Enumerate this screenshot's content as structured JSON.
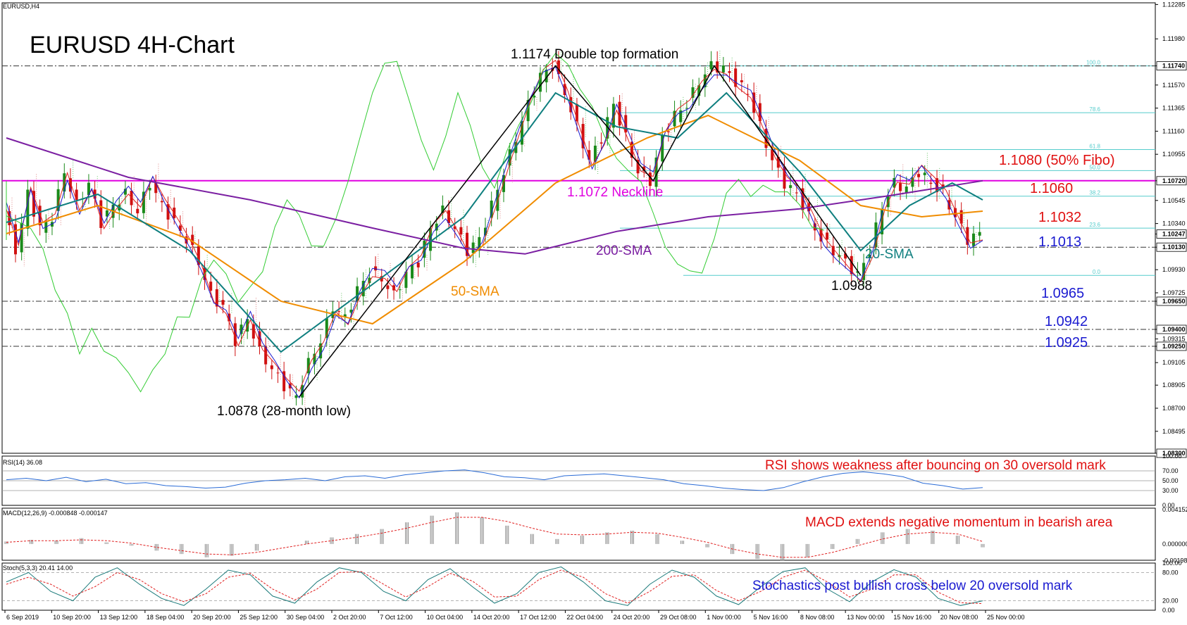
{
  "window_title": "EURUSD,H4",
  "chart_title": "EURUSD 4H-Chart",
  "colors": {
    "background": "#ffffff",
    "candle_up": "#1a8a1a",
    "candle_down": "#d01010",
    "sma20": "#0f7f7f",
    "sma50": "#f08c00",
    "sma200": "#7b1fa2",
    "neckline": "#e000e0",
    "tenkan": "#e02020",
    "kijun": "#1a1ad0",
    "chikou": "#33cc33",
    "fib": "#55cccc",
    "rsi": "#2a6bd6",
    "macd_signal": "#e02020",
    "stoch_signal": "#e02020"
  },
  "annotations": {
    "double_top": "1.1174 Double top formation",
    "neckline": "1.1072 Neckline",
    "fib50": "1.1080 (50% Fibo)",
    "level_1060": "1.1060",
    "level_1032": "1.1032",
    "level_1013": "1.1013",
    "level_0965": "1.0965",
    "level_0942": "1.0942",
    "level_0925": "1.0925",
    "low_0988": "1.0988",
    "low_0878": "1.0878 (28-month low)",
    "sma200_label": "200-SMA",
    "sma50_label": "50-SMA",
    "sma20_label": "20-SMA",
    "rsi_note": "RSI shows weakness after bouncing on 30 oversold mark",
    "macd_note": "MACD extends negative momentum in bearish area",
    "stoch_note": "Stochastics post bullish cross below 20 oversold mark"
  },
  "indicators": {
    "rsi_header": "RSI(14) 36.08",
    "macd_header": "MACD(12,26,9) -0.000848 -0.000147",
    "stoch_header": "Stoch(5,3,3) 20.41 14.00"
  },
  "chart_data": [
    {
      "type": "candlestick",
      "title": "EURUSD 4H-Chart",
      "symbol": "EURUSD",
      "timeframe": "H4",
      "ylim": [
        1.083,
        1.123
      ],
      "y_ticks": [
        "1.12285",
        "1.11980",
        "1.11740",
        "1.11570",
        "1.11365",
        "1.11160",
        "1.10955",
        "1.10720",
        "1.10545",
        "1.10340",
        "1.10247",
        "1.10130",
        "1.09930",
        "1.09725",
        "1.09650",
        "1.09400",
        "1.09315",
        "1.09250",
        "1.09105",
        "1.08905",
        "1.08700",
        "1.08495",
        "1.08300"
      ],
      "x_ticks": [
        "6 Sep 2019",
        "10 Sep 20:00",
        "13 Sep 12:00",
        "18 Sep 04:00",
        "20 Sep 20:00",
        "25 Sep 12:00",
        "30 Sep 04:00",
        "2 Oct 20:00",
        "7 Oct 12:00",
        "10 Oct 04:00",
        "14 Oct 20:00",
        "17 Oct 12:00",
        "22 Oct 04:00",
        "24 Oct 20:00",
        "29 Oct 08:00",
        "1 Nov 00:00",
        "5 Nov 16:00",
        "8 Nov 08:00",
        "13 Nov 00:00",
        "15 Nov 16:00",
        "20 Nov 08:00",
        "25 Nov 00:00"
      ],
      "price_labels": [
        "1.11740",
        "1.10720",
        "1.10247",
        "1.10130",
        "1.09650",
        "1.09400",
        "1.09250",
        "1.08300"
      ],
      "fibonacci": [
        {
          "label": "100.0",
          "value": 1.1174
        },
        {
          "label": "78.6",
          "value": 1.11324
        },
        {
          "label": "61.8",
          "value": 1.10997
        },
        {
          "label": "50.0",
          "value": 1.1081
        },
        {
          "label": "38.2",
          "value": 1.10583
        },
        {
          "label": "23.6",
          "value": 1.10299
        },
        {
          "label": "0.0",
          "value": 1.0988
        }
      ],
      "horizontal_levels": [
        {
          "value": 1.1174,
          "style": "dash-dot"
        },
        {
          "value": 1.1072,
          "style": "solid",
          "color": "neckline"
        },
        {
          "value": 1.1013,
          "style": "dash-dot"
        },
        {
          "value": 1.0965,
          "style": "dash-dot"
        },
        {
          "value": 1.094,
          "style": "dash-dot"
        },
        {
          "value": 1.0925,
          "style": "dash-dot"
        }
      ],
      "price_path": [
        [
          0,
          1.1045
        ],
        [
          2,
          1.101
        ],
        [
          4,
          1.106
        ],
        [
          6,
          1.103
        ],
        [
          8,
          1.104
        ],
        [
          10,
          1.108
        ],
        [
          12,
          1.105
        ],
        [
          14,
          1.107
        ],
        [
          16,
          1.1035
        ],
        [
          18,
          1.105
        ],
        [
          20,
          1.106
        ],
        [
          22,
          1.1045
        ],
        [
          24,
          1.107
        ],
        [
          26,
          1.105
        ],
        [
          28,
          1.1035
        ],
        [
          30,
          1.102
        ],
        [
          32,
          1.1
        ],
        [
          34,
          1.097
        ],
        [
          36,
          1.096
        ],
        [
          38,
          1.093
        ],
        [
          40,
          1.095
        ],
        [
          42,
          1.092
        ],
        [
          44,
          1.0905
        ],
        [
          46,
          1.089
        ],
        [
          48,
          1.088
        ],
        [
          50,
          1.091
        ],
        [
          52,
          1.093
        ],
        [
          54,
          1.096
        ],
        [
          56,
          1.095
        ],
        [
          58,
          1.0975
        ],
        [
          60,
          1.099
        ],
        [
          62,
          1.0985
        ],
        [
          64,
          1.097
        ],
        [
          66,
          1.099
        ],
        [
          68,
          1.1
        ],
        [
          70,
          1.103
        ],
        [
          72,
          1.1045
        ],
        [
          74,
          1.103
        ],
        [
          76,
          1.101
        ],
        [
          78,
          1.102
        ],
        [
          80,
          1.105
        ],
        [
          82,
          1.108
        ],
        [
          84,
          1.111
        ],
        [
          86,
          1.114
        ],
        [
          88,
          1.1165
        ],
        [
          90,
          1.1174
        ],
        [
          92,
          1.115
        ],
        [
          94,
          1.112
        ],
        [
          96,
          1.109
        ],
        [
          98,
          1.111
        ],
        [
          100,
          1.114
        ],
        [
          102,
          1.111
        ],
        [
          104,
          1.108
        ],
        [
          106,
          1.1072
        ],
        [
          108,
          1.111
        ],
        [
          110,
          1.113
        ],
        [
          112,
          1.114
        ],
        [
          114,
          1.116
        ],
        [
          116,
          1.1174
        ],
        [
          118,
          1.1172
        ],
        [
          120,
          1.116
        ],
        [
          122,
          1.115
        ],
        [
          124,
          1.112
        ],
        [
          126,
          1.109
        ],
        [
          128,
          1.107
        ],
        [
          130,
          1.106
        ],
        [
          132,
          1.104
        ],
        [
          134,
          1.102
        ],
        [
          136,
          1.101
        ],
        [
          138,
          1.1
        ],
        [
          140,
          1.0988
        ],
        [
          142,
          1.101
        ],
        [
          144,
          1.105
        ],
        [
          146,
          1.107
        ],
        [
          148,
          1.1065
        ],
        [
          150,
          1.108
        ],
        [
          152,
          1.107
        ],
        [
          154,
          1.106
        ],
        [
          156,
          1.104
        ],
        [
          158,
          1.102
        ],
        [
          160,
          1.1025
        ]
      ],
      "sma200": [
        [
          0,
          1.111
        ],
        [
          20,
          1.1075
        ],
        [
          40,
          1.1055
        ],
        [
          60,
          1.103
        ],
        [
          75,
          1.1012
        ],
        [
          85,
          1.1007
        ],
        [
          100,
          1.1027
        ],
        [
          115,
          1.104
        ],
        [
          130,
          1.1047
        ],
        [
          145,
          1.1059
        ],
        [
          160,
          1.1072
        ]
      ],
      "sma50": [
        [
          0,
          1.1025
        ],
        [
          15,
          1.105
        ],
        [
          30,
          1.102
        ],
        [
          45,
          1.0965
        ],
        [
          60,
          1.0945
        ],
        [
          75,
          1.1
        ],
        [
          90,
          1.107
        ],
        [
          105,
          1.111
        ],
        [
          115,
          1.113
        ],
        [
          130,
          1.109
        ],
        [
          140,
          1.105
        ],
        [
          150,
          1.104
        ],
        [
          160,
          1.1045
        ]
      ],
      "sma20": [
        [
          0,
          1.1035
        ],
        [
          15,
          1.106
        ],
        [
          30,
          1.101
        ],
        [
          45,
          1.092
        ],
        [
          60,
          1.098
        ],
        [
          75,
          1.104
        ],
        [
          90,
          1.115
        ],
        [
          100,
          1.112
        ],
        [
          110,
          1.111
        ],
        [
          118,
          1.115
        ],
        [
          130,
          1.108
        ],
        [
          140,
          1.101
        ],
        [
          148,
          1.105
        ],
        [
          155,
          1.107
        ],
        [
          160,
          1.1055
        ]
      ]
    },
    {
      "type": "line",
      "title": "RSI(14) 36.08",
      "ylim": [
        0,
        100
      ],
      "y_ticks": [
        "100.00",
        "70.00",
        "50.00",
        "30.00",
        "0.00"
      ],
      "series": [
        {
          "name": "RSI(14)",
          "values": [
            52,
            55,
            50,
            57,
            48,
            53,
            44,
            46,
            40,
            38,
            35,
            37,
            45,
            50,
            52,
            55,
            50,
            58,
            60,
            55,
            62,
            66,
            70,
            72,
            66,
            58,
            56,
            52,
            60,
            62,
            64,
            60,
            56,
            52,
            44,
            40,
            35,
            32,
            30,
            36,
            48,
            58,
            65,
            68,
            64,
            58,
            45,
            40,
            33,
            36
          ]
        }
      ]
    },
    {
      "type": "bar",
      "title": "MACD(12,26,9) -0.000848 -0.000147",
      "ylim": [
        -0.00195,
        0.0043
      ],
      "y_ticks": [
        "0.004152",
        "0.000000",
        "-0.001981"
      ],
      "series": [
        {
          "name": "MACD",
          "values": [
            0.0003,
            0.0005,
            0.0004,
            0.0007,
            0.0002,
            -0.0002,
            -0.0008,
            -0.0012,
            -0.0016,
            -0.0014,
            -0.0008,
            0.0,
            0.0004,
            0.0008,
            0.0012,
            0.0018,
            0.0026,
            0.0034,
            0.0038,
            0.0032,
            0.0022,
            0.0012,
            0.0006,
            0.001,
            0.0014,
            0.0016,
            0.0012,
            0.0004,
            -0.0004,
            -0.0012,
            -0.0018,
            -0.002,
            -0.0016,
            -0.0006,
            0.0006,
            0.0014,
            0.0018,
            0.0016,
            0.001,
            -0.0004
          ]
        },
        {
          "name": "Signal",
          "values": [
            0.0002,
            0.0004,
            0.0004,
            0.0005,
            0.0004,
            0.0001,
            -0.0004,
            -0.0008,
            -0.0012,
            -0.0013,
            -0.001,
            -0.0005,
            0.0,
            0.0004,
            0.0008,
            0.0013,
            0.0019,
            0.0026,
            0.0032,
            0.0032,
            0.0027,
            0.0019,
            0.0012,
            0.0011,
            0.0012,
            0.0014,
            0.0013,
            0.0008,
            0.0002,
            -0.0006,
            -0.0012,
            -0.0016,
            -0.0016,
            -0.001,
            -0.0002,
            0.0006,
            0.0012,
            0.0014,
            0.0012,
            0.0003
          ]
        }
      ]
    },
    {
      "type": "line",
      "title": "Stoch(5,3,3) 20.41 14.00",
      "ylim": [
        0,
        100
      ],
      "y_ticks": [
        "100.00",
        "80.00",
        "20.00",
        "0.00"
      ],
      "series": [
        {
          "name": "%K",
          "values": [
            60,
            80,
            40,
            20,
            70,
            90,
            55,
            25,
            10,
            45,
            85,
            75,
            30,
            15,
            60,
            90,
            80,
            40,
            20,
            65,
            88,
            50,
            15,
            35,
            80,
            92,
            60,
            20,
            10,
            55,
            85,
            70,
            30,
            12,
            50,
            82,
            90,
            45,
            18,
            60,
            86,
            70,
            25,
            10,
            20
          ]
        },
        {
          "name": "%D",
          "values": [
            55,
            70,
            55,
            30,
            50,
            80,
            65,
            35,
            18,
            35,
            70,
            78,
            45,
            22,
            45,
            80,
            82,
            55,
            28,
            50,
            78,
            62,
            28,
            30,
            65,
            85,
            70,
            35,
            15,
            40,
            72,
            75,
            42,
            20,
            40,
            70,
            85,
            60,
            28,
            45,
            75,
            75,
            38,
            16,
            14
          ]
        }
      ]
    }
  ]
}
